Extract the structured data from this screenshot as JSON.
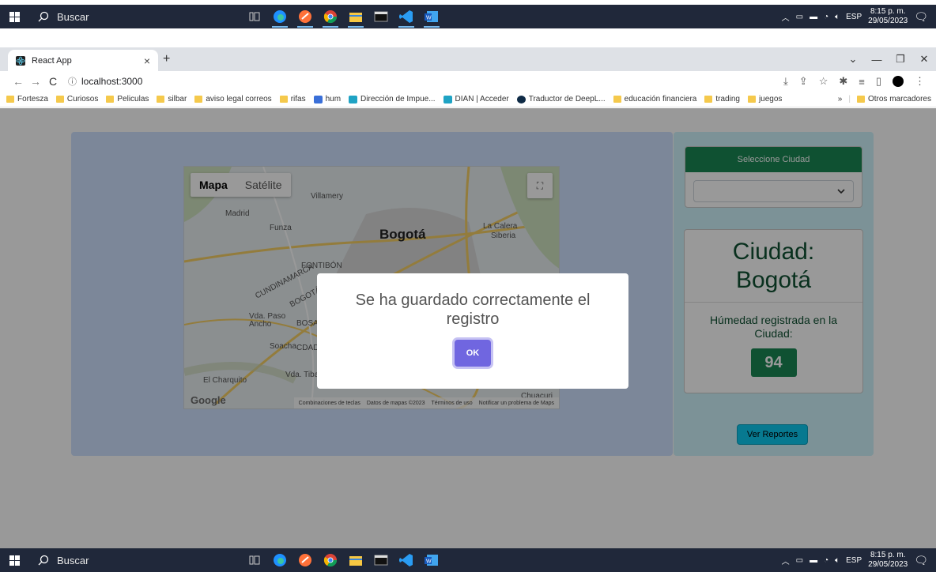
{
  "taskbar": {
    "search_label": "Buscar",
    "time": "8:15 p. m.",
    "date": "29/05/2023",
    "language": "ESP"
  },
  "browser": {
    "tab_title": "React App",
    "address": "localhost:3000",
    "bookmarks": [
      "Fortesza",
      "Curiosos",
      "Peliculas",
      "silbar",
      "aviso legal correos",
      "rifas",
      "hum",
      "Dirección de Impue...",
      "DIAN | Acceder",
      "Traductor de DeepL...",
      "educación financiera",
      "trading",
      "juegos"
    ],
    "bookmarks_more": "»",
    "other_bookmarks": "Otros marcadores"
  },
  "map": {
    "mode_map": "Mapa",
    "mode_satellite": "Satélite",
    "city_label": "Bogotá",
    "places": [
      "Madrid",
      "Funza",
      "Villamery",
      "La Calera",
      "Siberia",
      "FONTIBÓN",
      "CUNDINAMARCA",
      "BOGOTÁ",
      "Vda. Paso Ancho",
      "BOSA",
      "Soacha",
      "CDAD",
      "Vda. Tiba",
      "El Charquito",
      "Chuacuri"
    ],
    "google": "Google",
    "footer": [
      "Combinaciones de teclas",
      "Datos de mapas ©2023",
      "Términos de uso",
      "Notificar un problema de Maps"
    ]
  },
  "sidebar": {
    "select_header": "Seleccione Ciudad",
    "select_value": "",
    "city_heading_line1": "Ciudad:",
    "city_heading_line2": "Bogotá",
    "humidity_label": "Húmedad registrada en la Ciudad:",
    "humidity_value": "94",
    "reports_button": "Ver Reportes"
  },
  "modal": {
    "message": "Se ha guardado correctamente el registro",
    "ok_label": "OK"
  },
  "colors": {
    "success": "#198754",
    "info": "#0dcaf0",
    "primary_light": "#cfe2ff",
    "modal_button": "#7066e0"
  }
}
